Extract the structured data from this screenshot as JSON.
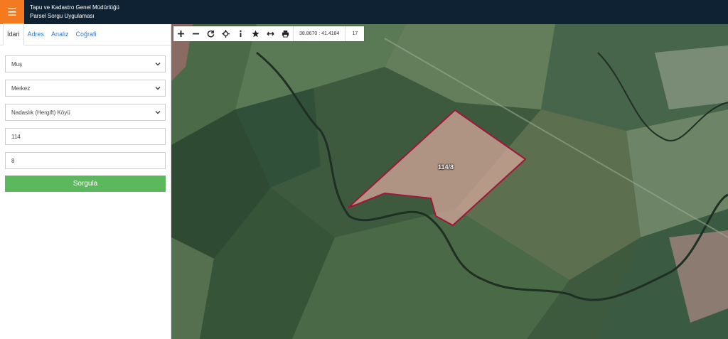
{
  "header": {
    "menu_icon": "hamburger-icon",
    "title_line1": "Tapu ve Kadastro Genel Müdürlüğü",
    "title_line2": "Parsel Sorgu Uygulaması",
    "colors": {
      "bar": "#0f2233",
      "menu_button": "#f47a20"
    }
  },
  "sidebar": {
    "tabs": [
      {
        "label": "İdari",
        "active": true
      },
      {
        "label": "Adres",
        "active": false
      },
      {
        "label": "Analiz",
        "active": false
      },
      {
        "label": "Coğrafi",
        "active": false
      }
    ],
    "province_select": "Muş",
    "district_select": "Merkez",
    "neighborhood_select": "Nadaslık (Hergift) Köyü",
    "block_input": "114",
    "parcel_input": "8",
    "query_button": "Sorgula",
    "query_button_color": "#5cb85c"
  },
  "map": {
    "toolbar": {
      "tools": [
        "zoom-in-icon",
        "zoom-out-icon",
        "refresh-icon",
        "locate-icon",
        "info-icon",
        "star-icon",
        "measure-icon",
        "print-icon"
      ],
      "coordinates": "38.8670 : 41.4184",
      "zoom_level": "17"
    },
    "parcel_label": "114/8",
    "parcel_outline_color": "#a0163a"
  }
}
